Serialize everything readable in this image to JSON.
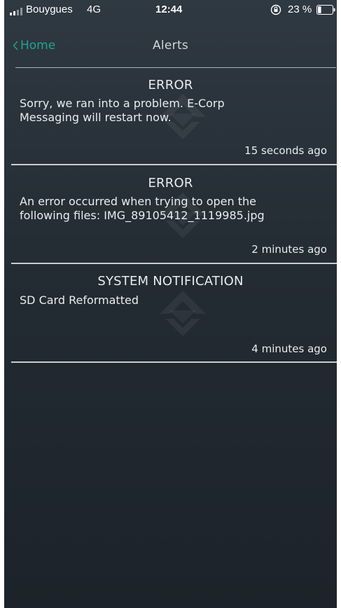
{
  "status_bar": {
    "carrier": "Bouygues",
    "network": "4G",
    "time": "12:44",
    "battery_percent": "23 %",
    "battery_level": 0.23,
    "icons": [
      "signal-icon",
      "orientation-lock-icon",
      "battery-icon"
    ]
  },
  "nav": {
    "back_label": "Home",
    "title": "Alerts",
    "back_icon": "chevron-left-icon"
  },
  "colors": {
    "accent": "#1ea593",
    "background_top": "#2f3941",
    "background_bottom": "#1c232a",
    "divider": "#c7cdd2",
    "text": "#e8ecef"
  },
  "watermark_icon": "e-corp-logo",
  "alerts": [
    {
      "title": "ERROR",
      "message_lines": [
        "Sorry, we ran into a problem. E-Corp",
        "Messaging will restart now."
      ],
      "time": "15 seconds ago"
    },
    {
      "title": "ERROR",
      "message_lines": [
        "An error occurred when trying to open the",
        "following files: IMG_89105412_1119985.jpg"
      ],
      "time": "2 minutes ago"
    },
    {
      "title": "SYSTEM NOTIFICATION",
      "message_lines": [
        "SD Card Reformatted"
      ],
      "time": "4 minutes ago"
    }
  ]
}
